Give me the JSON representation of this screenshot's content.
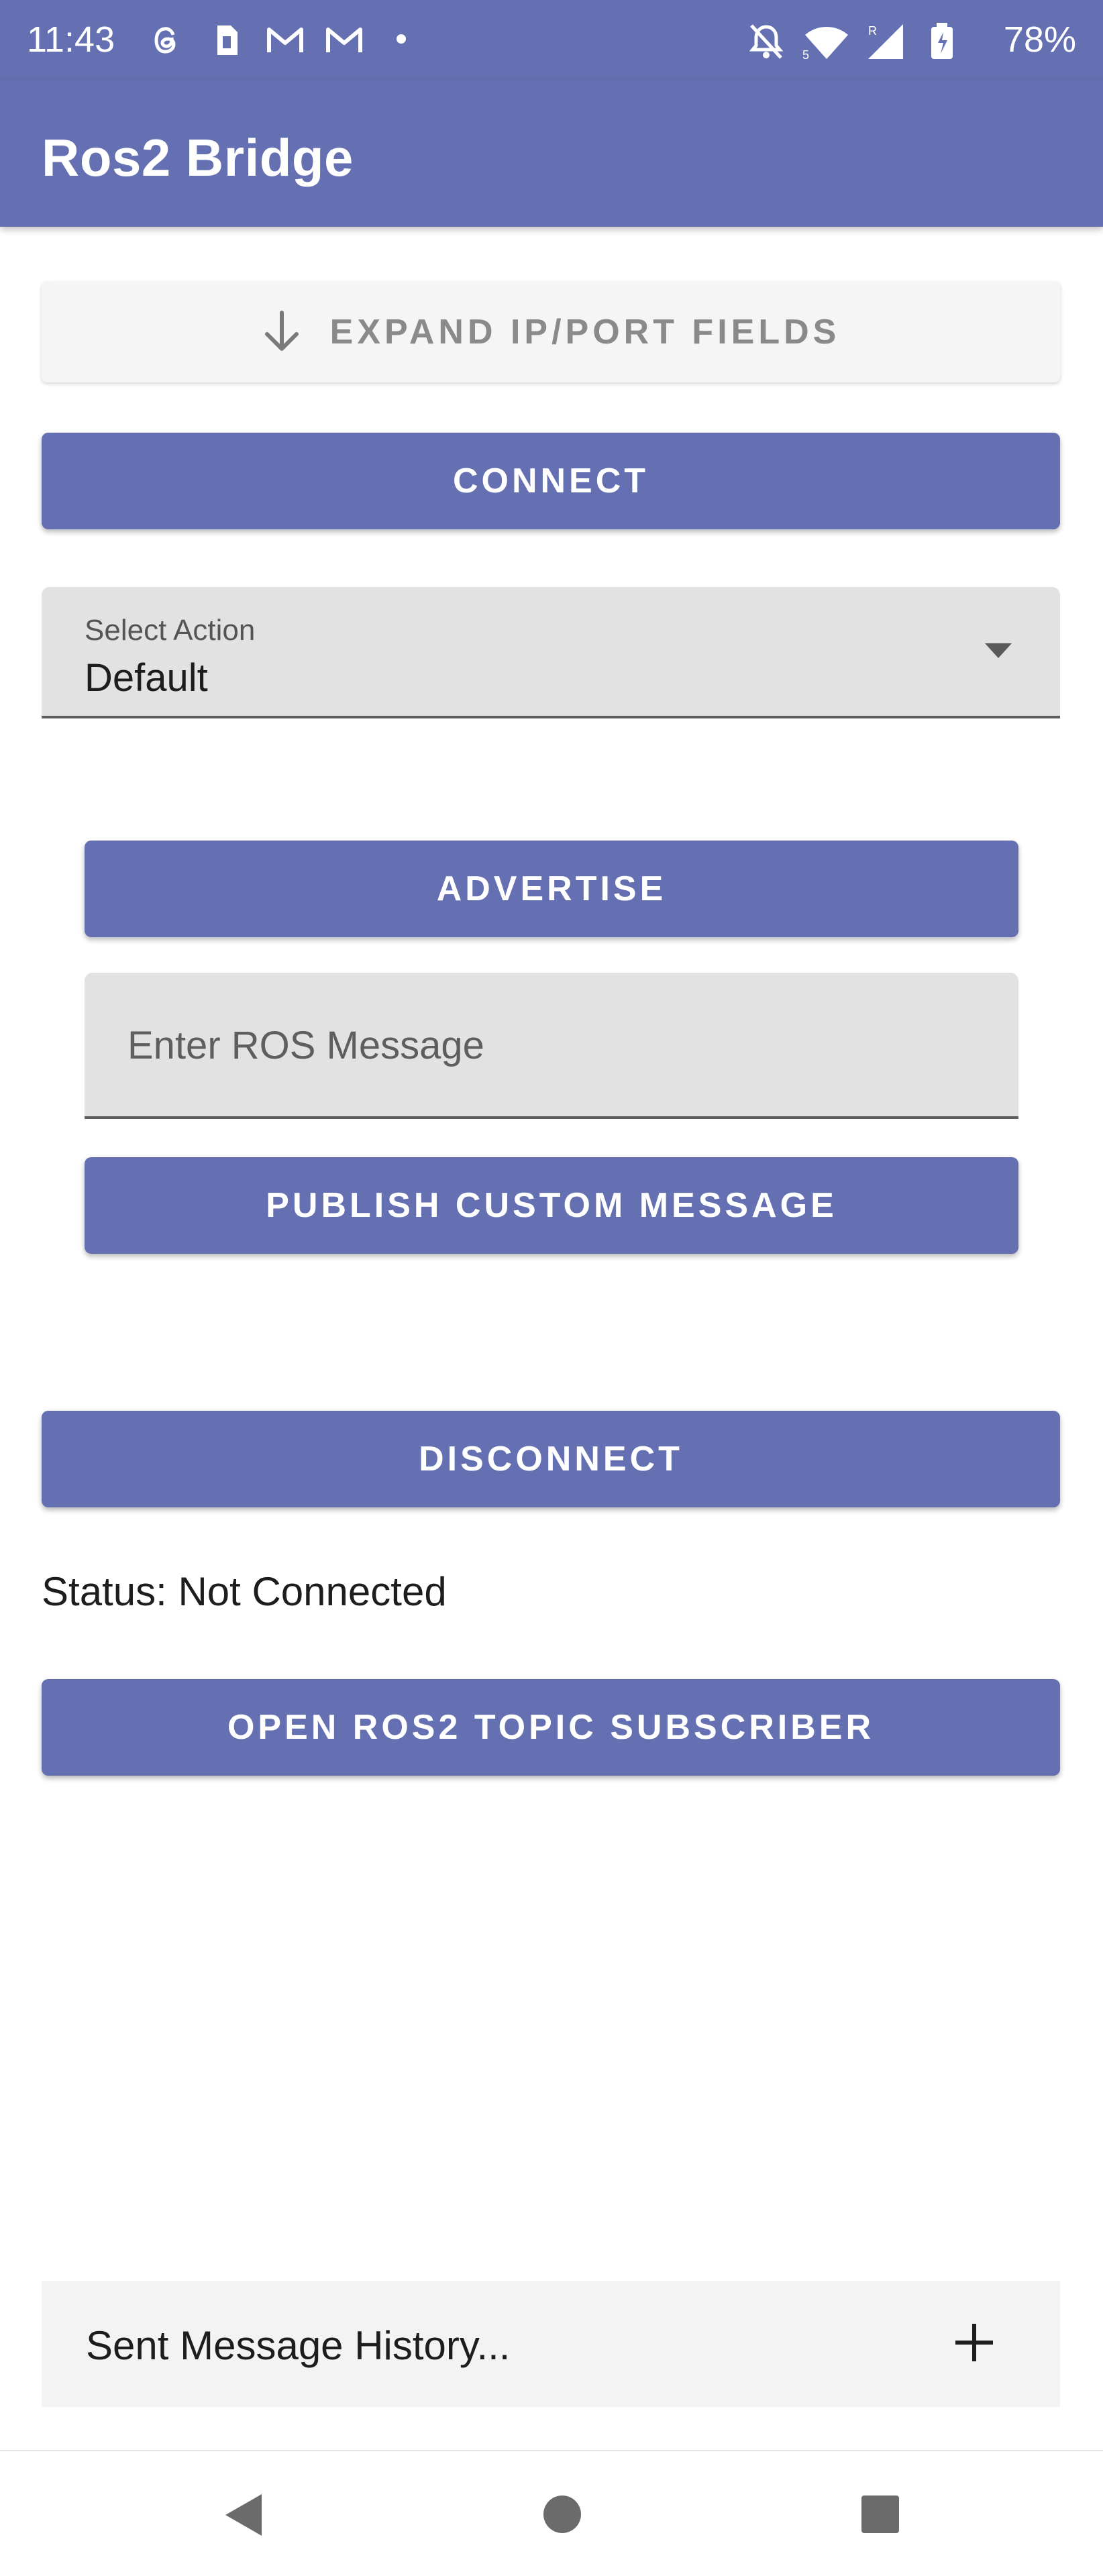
{
  "status_bar": {
    "time": "11:43",
    "battery_percent": "78%",
    "icons": [
      "threads-icon",
      "sim-icon",
      "gmail-icon",
      "gmail-icon",
      "dot-icon",
      "mute-bell-icon",
      "wifi-icon",
      "signal-icon",
      "battery-icon"
    ]
  },
  "app_bar": {
    "title": "Ros2 Bridge"
  },
  "expand_button": {
    "label": "EXPAND IP/PORT FIELDS",
    "icon": "arrow-down-icon"
  },
  "connect_button": {
    "label": "CONNECT"
  },
  "select_action": {
    "label": "Select Action",
    "value": "Default",
    "icon": "caret-down-icon"
  },
  "advertise_button": {
    "label": "ADVERTISE"
  },
  "ros_message_input": {
    "placeholder": "Enter ROS Message",
    "value": ""
  },
  "publish_button": {
    "label": "PUBLISH CUSTOM MESSAGE"
  },
  "disconnect_button": {
    "label": "DISCONNECT"
  },
  "status": {
    "text": "Status: Not Connected"
  },
  "open_subscriber_button": {
    "label": "OPEN ROS2 TOPIC SUBSCRIBER"
  },
  "history": {
    "label": "Sent Message History...",
    "icon": "plus-icon"
  },
  "navbar": {
    "icons": [
      "back-icon",
      "home-icon",
      "recents-icon"
    ]
  },
  "colors": {
    "primary": "#6470b2",
    "surface_variant": "#e2e2e2",
    "background": "#ffffff"
  }
}
